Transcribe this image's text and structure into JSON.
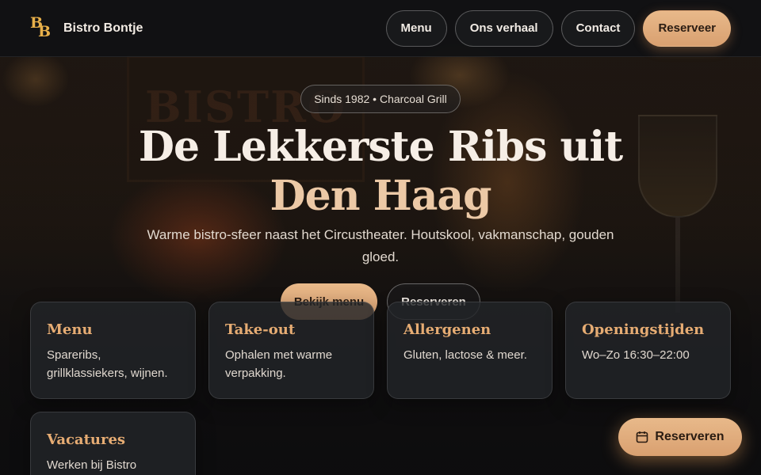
{
  "brand": {
    "monogram_1": "B",
    "monogram_2": "B",
    "name": "Bistro Bontje"
  },
  "nav": {
    "items": [
      {
        "label": "Menu"
      },
      {
        "label": "Ons verhaal"
      },
      {
        "label": "Contact"
      }
    ],
    "reserve_label": "Reserveer"
  },
  "hero": {
    "badge": "Sinds 1982 • Charcoal Grill",
    "title_line1": "De Lekkerste Ribs uit",
    "title_line2": "Den Haag",
    "subtitle": "Warme bistro-sfeer naast het Circustheater. Houtskool, vakmanschap, gouden gloed.",
    "cta_menu": "Bekijk menu",
    "cta_reserve": "Reserveren",
    "background_sign": "BISTRO"
  },
  "cards": [
    {
      "title": "Menu",
      "text": "Spareribs, grillklassiekers, wijnen."
    },
    {
      "title": "Take-out",
      "text": "Ophalen met warme verpakking."
    },
    {
      "title": "Allergenen",
      "text": "Gluten, lactose & meer."
    },
    {
      "title": "Openingstijden",
      "text": "Wo–Zo 16:30–22:00"
    },
    {
      "title": "Vacatures",
      "text": "Werken bij Bistro"
    }
  ],
  "floating": {
    "label": "Reserveren",
    "icon": "calendar-icon"
  },
  "colors": {
    "accent": "#d9a070",
    "heading_accent": "#e6ac73",
    "logo": "#e8b04a",
    "background": "#14110e"
  }
}
